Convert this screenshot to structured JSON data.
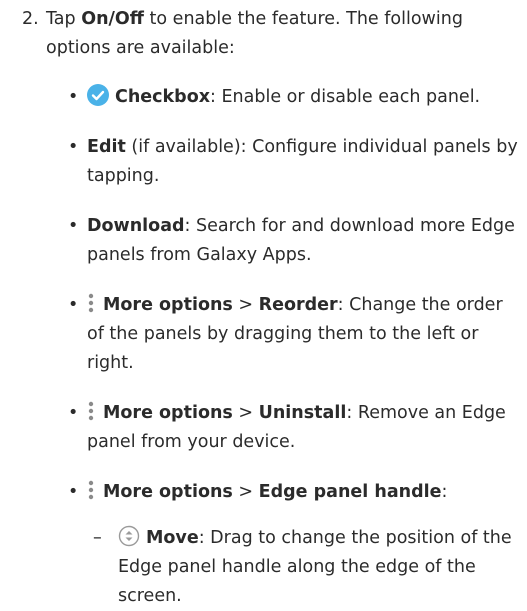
{
  "step": {
    "number": "2.",
    "intro_prefix": "Tap ",
    "intro_bold": "On/Off",
    "intro_suffix": " to enable the feature. The following options are available:"
  },
  "items": [
    {
      "icon": "checkbox-icon",
      "bold": "Checkbox",
      "text": ": Enable or disable each panel."
    },
    {
      "bold": "Edit",
      "text": " (if available): Configure individual panels by tapping."
    },
    {
      "bold": "Download",
      "text": ": Search for and download more Edge panels from Galaxy Apps."
    },
    {
      "icon": "more-options-icon",
      "bold": "More options",
      "sep": " > ",
      "bold2": "Reorder",
      "text": ": Change the order of the panels by dragging them to the left or right."
    },
    {
      "icon": "more-options-icon",
      "bold": "More options",
      "sep": " > ",
      "bold2": "Uninstall",
      "text": ": Remove an Edge panel from your device."
    },
    {
      "icon": "more-options-icon",
      "bold": "More options",
      "sep": " > ",
      "bold2": "Edge panel handle",
      "text": ":"
    }
  ],
  "sub_items": [
    {
      "icon": "move-icon",
      "bold": "Move",
      "text": ": Drag to change the position of the Edge panel handle along the edge of the screen."
    }
  ],
  "colors": {
    "text": "#2b2b2b",
    "checkbox_accent": "#4ab2e8",
    "icon_gray": "#8a8a8a"
  }
}
